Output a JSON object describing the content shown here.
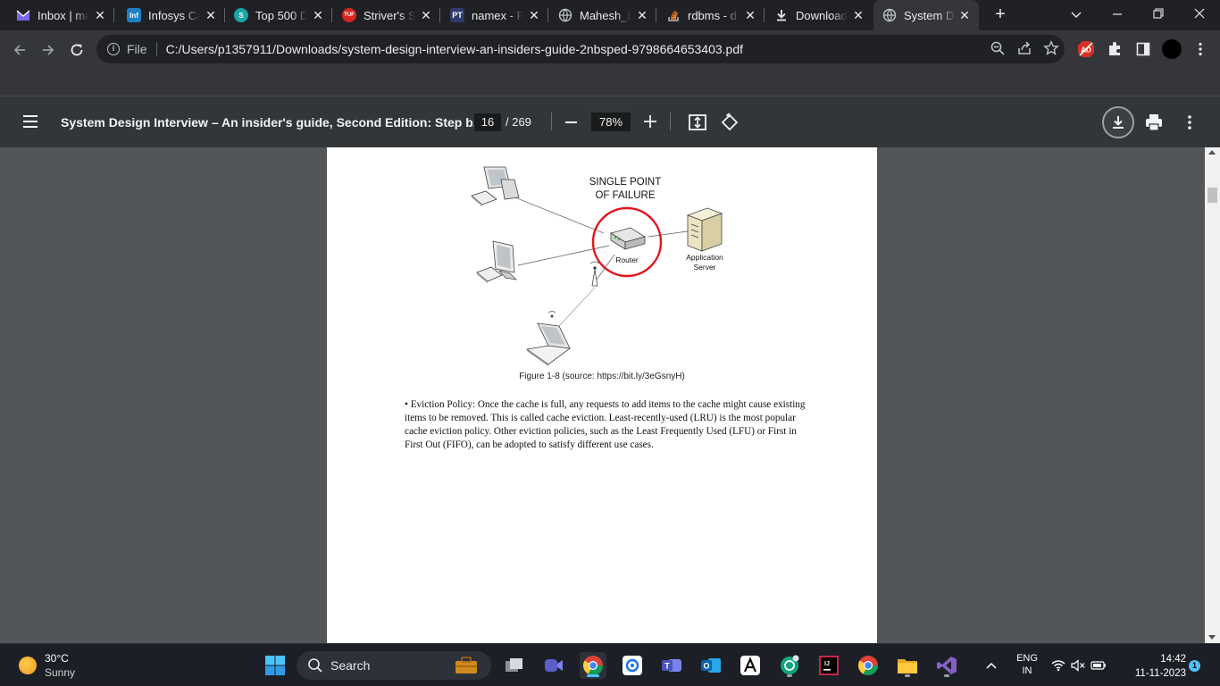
{
  "tabs": [
    {
      "label": "Inbox | ma",
      "icon": "mail-icon",
      "color": "#7b68ee"
    },
    {
      "label": "Infosys Ca",
      "icon": "infosys-icon",
      "color": "#1d7fc3"
    },
    {
      "label": "Top 500 D",
      "icon": "globe-teal-icon",
      "color": "#1aa6a6"
    },
    {
      "label": "Striver's S",
      "icon": "tuf-icon",
      "color": "#d7261e"
    },
    {
      "label": "namex - P",
      "icon": "pt-icon",
      "color": "#2f3b6b"
    },
    {
      "label": "Mahesh_D",
      "icon": "globe-icon",
      "color": "#9aa0a6"
    },
    {
      "label": "rdbms - d",
      "icon": "stackoverflow-icon",
      "color": "#f48024"
    },
    {
      "label": "Download",
      "icon": "download-icon",
      "color": "#e8eaed"
    },
    {
      "label": "System D",
      "icon": "globe-icon",
      "color": "#9aa0a6",
      "active": true
    }
  ],
  "omnibox": {
    "scheme": "File",
    "url": "C:/Users/p1357911/Downloads/system-design-interview-an-insiders-guide-2nbsped-9798664653403.pdf"
  },
  "pdf": {
    "title": "System Design Interview – An insider's guide, Second Edition: Step b...",
    "page": "16",
    "total": "/ 269",
    "zoom": "78%"
  },
  "figure": {
    "heading_line1": "SINGLE POINT",
    "heading_line2": "OF FAILURE",
    "router_label": "Router",
    "server_label_line1": "Application",
    "server_label_line2": "Server",
    "caption": "Figure 1-8 (source: https://bit.ly/3eGsnyH)"
  },
  "body_text": "• Eviction Policy: Once the cache is full, any requests to add items to the cache might cause existing items to be removed. This is called cache eviction. Least-recently-used (LRU) is the most popular cache eviction policy. Other eviction policies, such as the Least Frequently Used (LFU) or First in First Out (FIFO), can be adopted to satisfy different use cases.",
  "taskbar": {
    "weather_temp": "30°C",
    "weather_cond": "Sunny",
    "search_placeholder": "Search",
    "lang_line1": "ENG",
    "lang_line2": "IN",
    "time": "14:42",
    "date": "11-11-2023",
    "notification_count": "1"
  },
  "colors": {
    "accent_red": "#e0141e",
    "chrome_dark": "#202124",
    "pdf_toolbar": "#323639",
    "viewer_bg": "#525659"
  }
}
